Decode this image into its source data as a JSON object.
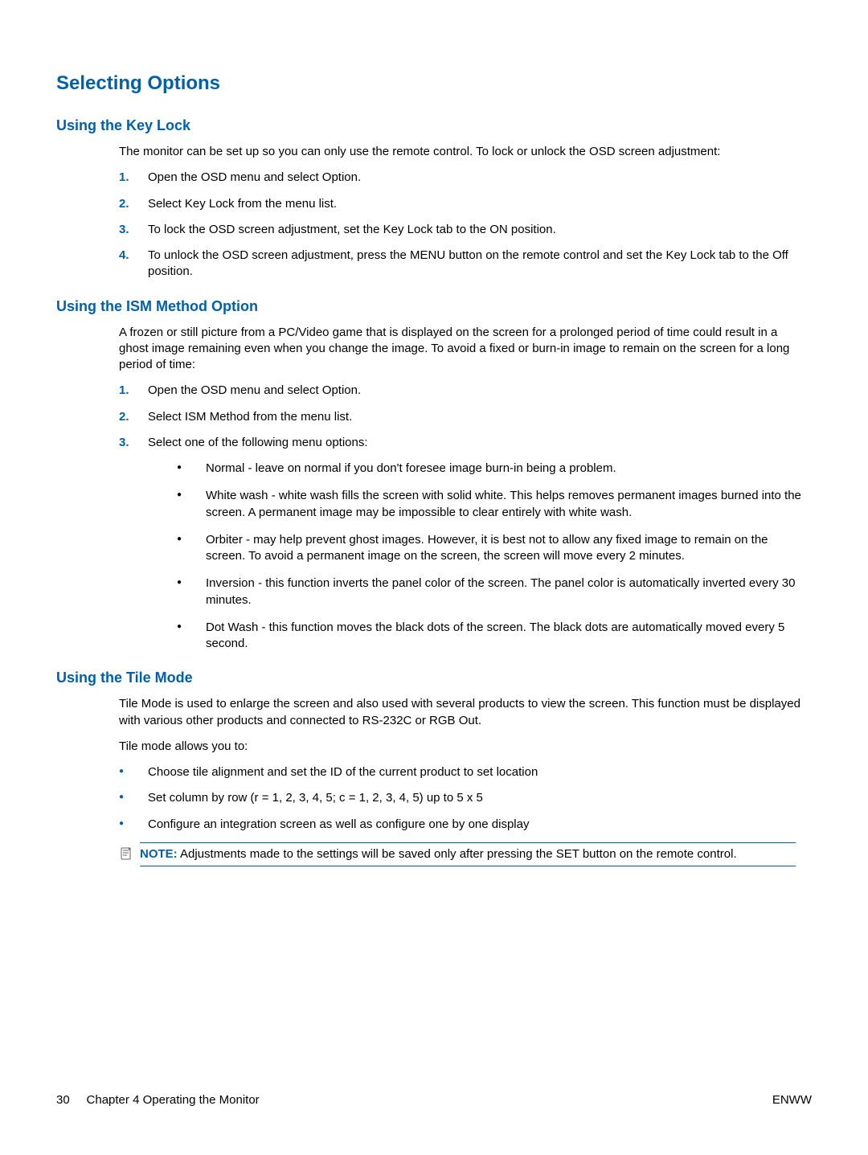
{
  "title": "Selecting Options",
  "s1": {
    "heading": "Using the Key Lock",
    "intro": "The monitor can be set up so you can only use the remote control. To lock or unlock the OSD screen adjustment:",
    "steps": [
      "Open the OSD menu and select Option.",
      "Select Key Lock from the menu list.",
      "To lock the OSD screen adjustment, set the Key Lock tab to the ON position.",
      "To unlock the OSD screen adjustment, press the MENU button on the remote control and set the Key Lock tab to the Off position."
    ]
  },
  "s2": {
    "heading": "Using the ISM Method Option",
    "intro": "A frozen or still picture from a PC/Video game that is displayed on the screen for a prolonged period of time could result in a ghost image remaining even when you change the image. To avoid a fixed or burn-in image to remain on the screen for a long period of time:",
    "steps": [
      "Open the OSD menu and select Option.",
      "Select ISM Method from the menu list.",
      "Select one of the following menu options:"
    ],
    "options": [
      "Normal - leave on normal if you don't foresee image burn-in being a problem.",
      "White wash - white wash fills the screen with solid white. This helps removes permanent images burned into the screen. A permanent image may be impossible to clear entirely with white wash.",
      "Orbiter - may help prevent ghost images. However, it is best not to allow any fixed image to remain on the screen. To avoid a permanent image on the screen, the screen will move every 2 minutes.",
      "Inversion - this function inverts the panel color of the screen. The panel color is automatically inverted every 30 minutes.",
      "Dot Wash - this function moves the black dots of the screen. The black dots are automatically moved every 5 second."
    ]
  },
  "s3": {
    "heading": "Using the Tile Mode",
    "p1": "Tile Mode is used to enlarge the screen and also used with several products to view the screen. This function must be displayed with various other products and connected to RS-232C or RGB Out.",
    "p2": "Tile mode allows you to:",
    "bullets": [
      "Choose tile alignment and set the ID of the current product to set location",
      "Set column by row (r = 1, 2, 3, 4, 5; c = 1, 2, 3, 4, 5) up to 5 x 5",
      "Configure an integration screen as well as configure one by one display"
    ],
    "note_label": "NOTE:",
    "note_text": "Adjustments made to the settings will be saved only after pressing the SET button on the remote control."
  },
  "footer": {
    "page_num": "30",
    "chapter": "Chapter 4   Operating the Monitor",
    "right": "ENWW"
  }
}
